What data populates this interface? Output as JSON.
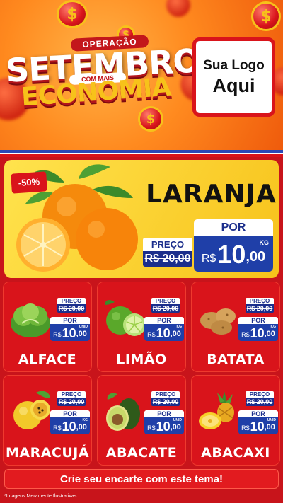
{
  "header": {
    "operacao": "OPERAÇÃO",
    "setembro": "SETEMBRO",
    "com_mais": "COM MAIS",
    "economia": "ECONOMIA",
    "logo_line1": "Sua Logo",
    "logo_line2": "Aqui",
    "coin_symbol": "$"
  },
  "featured": {
    "discount": "-50%",
    "name": "LARANJA",
    "preco_label": "PREÇO",
    "old_price": "R$ 20,00",
    "por_label": "POR",
    "currency": "R$",
    "price_int": "10",
    "price_cents": ",00",
    "unit": "KG"
  },
  "products": [
    {
      "name": "ALFACE",
      "preco_label": "PREÇO",
      "old_price": "R$ 20,00",
      "por_label": "POR",
      "currency": "R$",
      "price_int": "10",
      "price_cents": ",00",
      "unit": "UNID",
      "icon": "lettuce-icon"
    },
    {
      "name": "LIMÃO",
      "preco_label": "PREÇO",
      "old_price": "R$ 20,00",
      "por_label": "POR",
      "currency": "R$",
      "price_int": "10",
      "price_cents": ",00",
      "unit": "KG",
      "icon": "lime-icon"
    },
    {
      "name": "BATATA",
      "preco_label": "PREÇO",
      "old_price": "R$ 20,00",
      "por_label": "POR",
      "currency": "R$",
      "price_int": "10",
      "price_cents": ",00",
      "unit": "KG",
      "icon": "potato-icon"
    },
    {
      "name": "MARACUJÁ",
      "preco_label": "PREÇO",
      "old_price": "R$ 20,00",
      "por_label": "POR",
      "currency": "R$",
      "price_int": "10",
      "price_cents": ",00",
      "unit": "KG",
      "icon": "passionfruit-icon"
    },
    {
      "name": "ABACATE",
      "preco_label": "PREÇO",
      "old_price": "R$ 20,00",
      "por_label": "POR",
      "currency": "R$",
      "price_int": "10",
      "price_cents": ",00",
      "unit": "UNID",
      "icon": "avocado-icon"
    },
    {
      "name": "ABACAXI",
      "preco_label": "PREÇO",
      "old_price": "R$ 20,00",
      "por_label": "POR",
      "currency": "R$",
      "price_int": "10",
      "price_cents": ",00",
      "unit": "UNID",
      "icon": "pineapple-icon"
    }
  ],
  "cta": "Crie seu encarte com este tema!",
  "footer": "*Imagens Meramente Ilustrativas",
  "colors": {
    "brand_red": "#d9141b",
    "price_blue": "#1f3fa8",
    "gold": "#f7c21a",
    "orange": "#ff8a1f"
  }
}
